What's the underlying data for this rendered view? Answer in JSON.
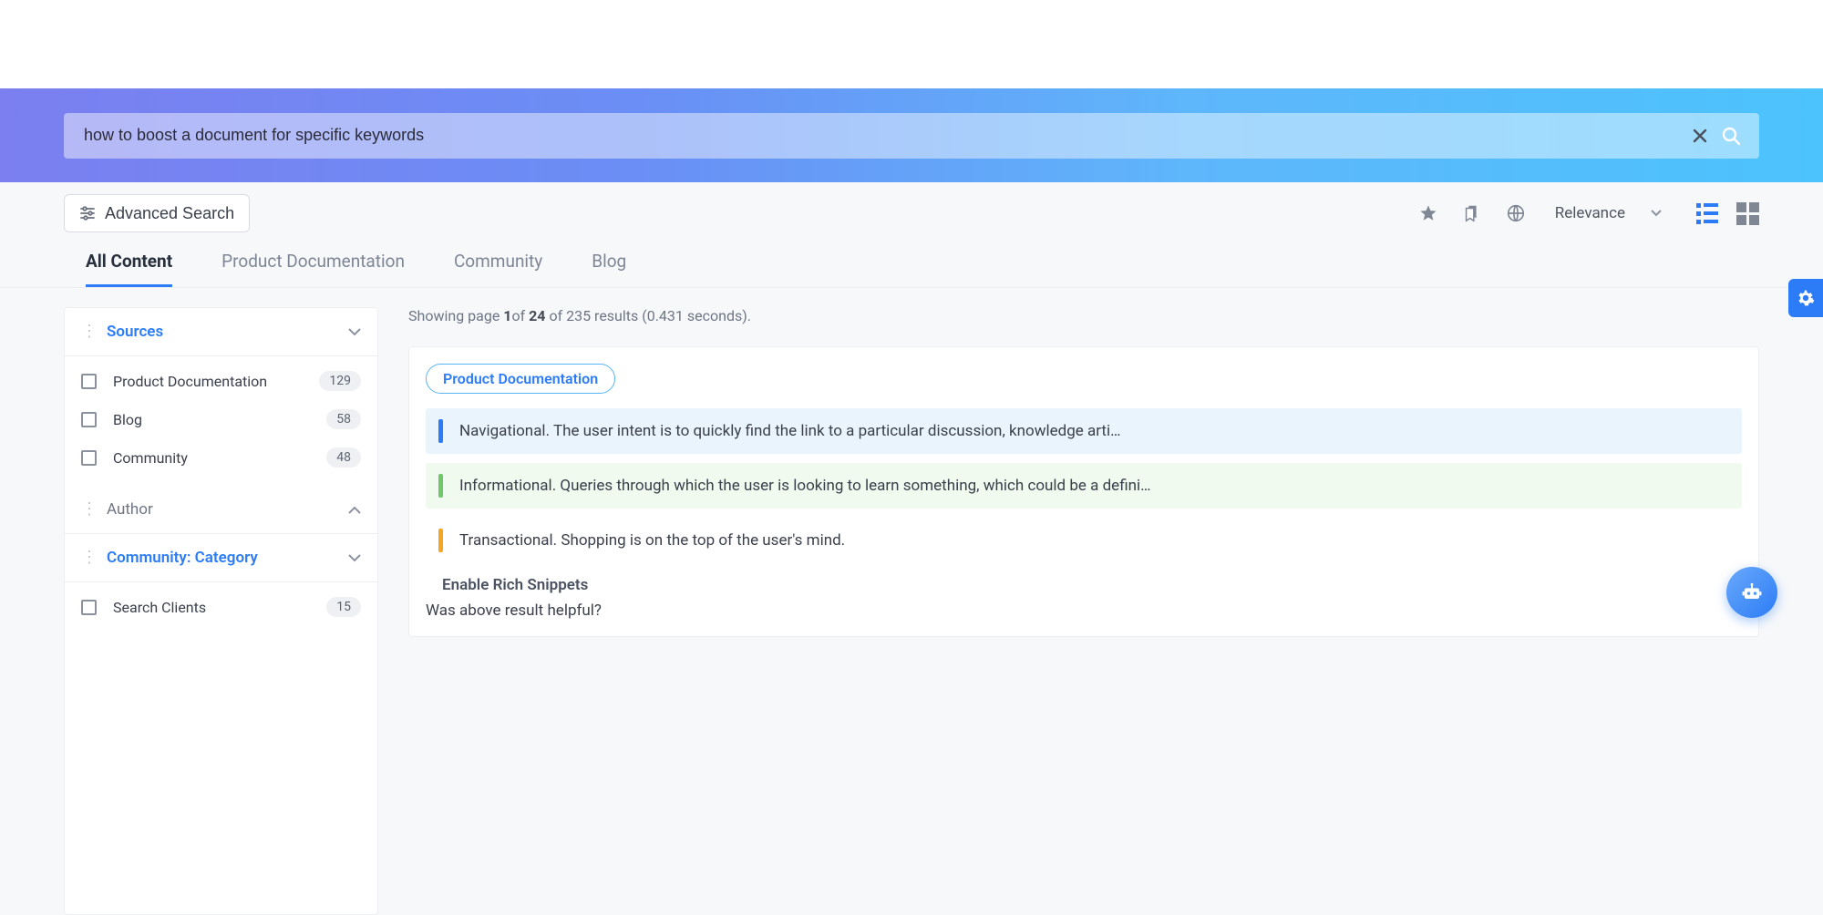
{
  "search": {
    "query": "how to boost a document for specific keywords"
  },
  "toolbar": {
    "advanced_label": "Advanced Search",
    "sort_label": "Relevance"
  },
  "tabs": [
    {
      "label": "All Content"
    },
    {
      "label": "Product Documentation"
    },
    {
      "label": "Community"
    },
    {
      "label": "Blog"
    }
  ],
  "facets": {
    "sources": {
      "title": "Sources",
      "items": [
        {
          "label": "Product Documentation",
          "count": "129"
        },
        {
          "label": "Blog",
          "count": "58"
        },
        {
          "label": "Community",
          "count": "48"
        }
      ]
    },
    "author": {
      "title": "Author"
    },
    "community_category": {
      "title": "Community: Category",
      "items": [
        {
          "label": "Search Clients",
          "count": "15"
        }
      ]
    }
  },
  "results": {
    "summary_prefix": "Showing page ",
    "page": "1",
    "summary_mid1": "of ",
    "pages": "24",
    "summary_mid2": " of 235 results (0.431 seconds).",
    "chip": "Product Documentation",
    "snips": [
      "Navigational. The user intent is to quickly find the link to a particular discussion, knowledge arti…",
      "Informational. Queries through which the user is looking to learn something, which could be a defini…",
      "Transactional. Shopping is on the top of the user's mind."
    ],
    "enable_link": "Enable Rich Snippets",
    "helpful": "Was above result helpful?"
  }
}
